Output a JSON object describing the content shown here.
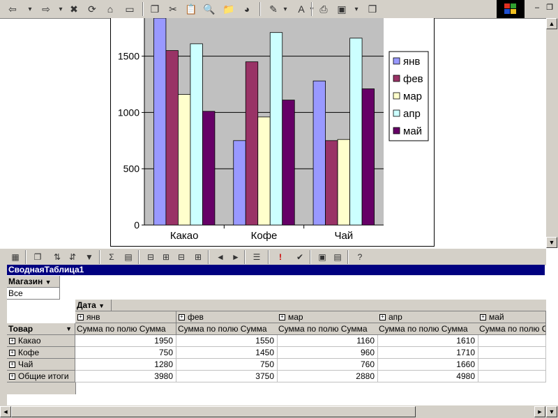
{
  "toolbar": {
    "icons": [
      "back-icon",
      "back-dropdown-icon",
      "forward-icon",
      "forward-dropdown-icon",
      "stop-icon",
      "refresh-icon",
      "home-icon",
      "fullscreen-icon",
      "copy-icon",
      "cut-icon",
      "paste-icon",
      "find-icon",
      "open-folder-icon",
      "web-icon",
      "edit-icon",
      "edit-dropdown-icon",
      "font-icon",
      "font-dropdown-icon",
      "print-icon",
      "view-icon",
      "view-dropdown-icon",
      "window-icon"
    ],
    "glyphs": [
      "⇦",
      "▾",
      "⇨",
      "▾",
      "✖",
      "⟳",
      "⌂",
      "▭",
      "❐",
      "✂",
      "📋",
      "🔍",
      "📁",
      "◕",
      "✎",
      "▾",
      "A",
      "▾",
      "⎙",
      "▣",
      "▾",
      "❒"
    ]
  },
  "window_controls": {
    "minimize": "–",
    "restore": "❐"
  },
  "chart_data": {
    "type": "bar",
    "categories": [
      "Какао",
      "Кофе",
      "Чай"
    ],
    "series": [
      {
        "name": "янв",
        "values": [
          1950,
          750,
          1280
        ],
        "color": "#9999ff"
      },
      {
        "name": "фев",
        "values": [
          1550,
          1450,
          750
        ],
        "color": "#993366"
      },
      {
        "name": "мар",
        "values": [
          1160,
          960,
          760
        ],
        "color": "#ffffcc"
      },
      {
        "name": "апр",
        "values": [
          1610,
          1710,
          1660
        ],
        "color": "#ccffff"
      },
      {
        "name": "май",
        "values": [
          1010,
          1110,
          1210
        ],
        "color": "#660066"
      }
    ],
    "yticks": [
      "0",
      "500",
      "1000",
      "1500"
    ],
    "ylim": [
      0,
      1900
    ],
    "grid": true,
    "legend": "right",
    "plot_background": "#c0c0c0"
  },
  "pivot_toolbar": {
    "icons": [
      "office-icon",
      "copy-icon",
      "sort-asc-icon",
      "sort-desc-icon",
      "autofilter-icon",
      "autosum-icon",
      "calc-icon",
      "collapse-icon",
      "expand-icon",
      "hide-details-icon",
      "show-details-icon",
      "move-left-icon",
      "move-right-icon",
      "field-list-icon",
      "exclamation-icon",
      "export-icon",
      "properties-icon",
      "list-icon",
      "help-icon"
    ],
    "glyphs": [
      "▦",
      "❐",
      "⇅",
      "⇵",
      "▼",
      "Σ",
      "▤",
      "⊟",
      "⊞",
      "⊟",
      "⊞",
      "◄",
      "►",
      "☰",
      "!",
      "✔",
      "▣",
      "▤",
      "?"
    ]
  },
  "pivot": {
    "title": "СводнаяТаблица1",
    "filter_field": "Магазин",
    "filter_value": "Все",
    "column_field": "Дата",
    "row_field": "Товар",
    "months": [
      "янв",
      "фев",
      "мар",
      "апр",
      "май"
    ],
    "measure": "Сумма по полю Сумма",
    "rows": [
      {
        "label": "Какао",
        "values": [
          "1950",
          "1550",
          "1160",
          "1610",
          ""
        ]
      },
      {
        "label": "Кофе",
        "values": [
          "750",
          "1450",
          "960",
          "1710",
          ""
        ]
      },
      {
        "label": "Чай",
        "values": [
          "1280",
          "750",
          "760",
          "1660",
          ""
        ]
      },
      {
        "label": "Общие итоги",
        "values": [
          "3980",
          "3750",
          "2880",
          "4980",
          ""
        ]
      }
    ]
  }
}
